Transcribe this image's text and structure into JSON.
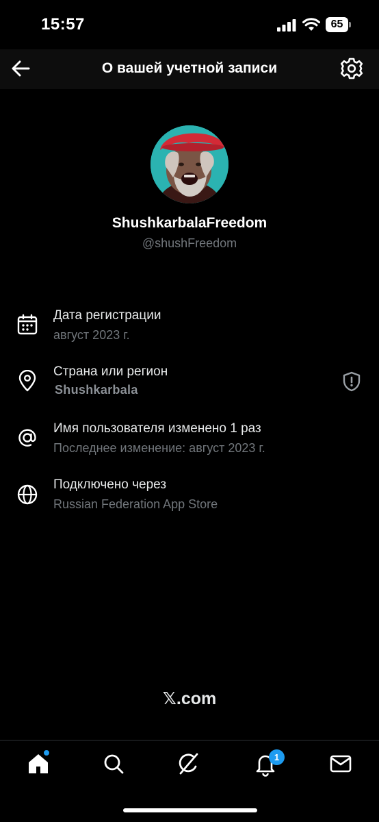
{
  "status_bar": {
    "time": "15:57",
    "battery": "65",
    "icons": [
      "signal-icon",
      "wifi-icon",
      "battery-icon"
    ]
  },
  "header": {
    "title": "О вашей учетной записи",
    "back_icon": "arrow-left-icon",
    "settings_icon": "gear-icon"
  },
  "profile": {
    "display_name": "ShushkarbalaFreedom",
    "handle": "@shushFreedom"
  },
  "info": [
    {
      "icon": "calendar-icon",
      "title": "Дата регистрации",
      "subtitle": "август 2023 г."
    },
    {
      "icon": "location-pin-icon",
      "title": "Страна или регион",
      "subtitle": "Shushkarbala",
      "action_icon": "shield-icon"
    },
    {
      "icon": "at-sign-icon",
      "title": "Имя пользователя изменено 1 раз",
      "subtitle": "Последнее изменение: август 2023 г."
    },
    {
      "icon": "globe-icon",
      "title": "Подключено через",
      "subtitle": "Russian Federation App Store"
    }
  ],
  "footer": {
    "brand": "𝕏.com"
  },
  "tab_bar": {
    "tabs": [
      "home-icon",
      "search-icon",
      "grok-icon",
      "bell-icon",
      "mail-icon"
    ],
    "notifications_count": "1",
    "accent_color": "#1d9bf0"
  }
}
